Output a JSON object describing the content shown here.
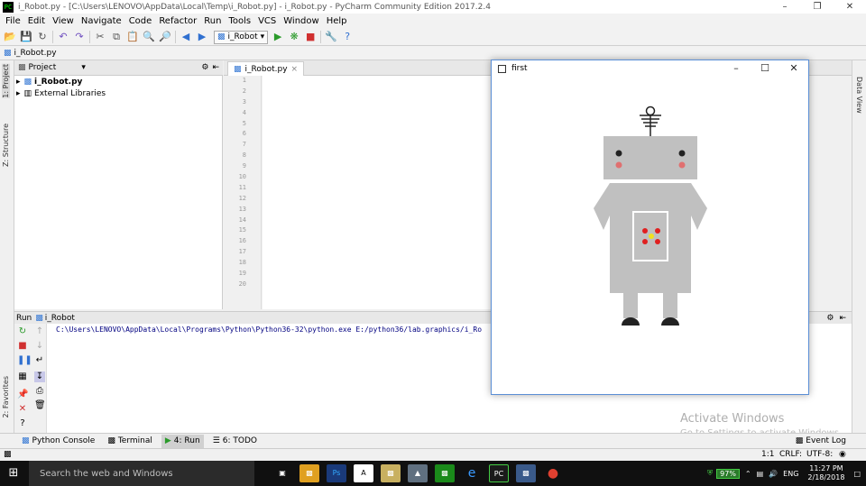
{
  "window": {
    "title": "i_Robot.py - [C:\\Users\\LENOVO\\AppData\\Local\\Temp\\i_Robot.py] - i_Robot.py - PyCharm Community Edition 2017.2.4",
    "app_icon_text": "PC",
    "controls": {
      "minimize": "–",
      "restore": "❐",
      "close": "✕"
    }
  },
  "menu": [
    "File",
    "Edit",
    "View",
    "Navigate",
    "Code",
    "Refactor",
    "Run",
    "Tools",
    "VCS",
    "Window",
    "Help"
  ],
  "toolbar": {
    "run_config": "i_Robot"
  },
  "navbar": {
    "breadcrumb": "i_Robot.py"
  },
  "left_strip": {
    "project_tab": "1: Project",
    "structure_tab": "Z: Structure",
    "favorites_tab": "2: Favorites"
  },
  "right_strip": {
    "data_view_tab": "Data View"
  },
  "project": {
    "header": "Project",
    "items": [
      {
        "label": "i_Robot.py"
      },
      {
        "label": "External Libraries"
      }
    ]
  },
  "editor": {
    "tab": "i_Robot.py",
    "line_numbers": [
      "1",
      "2",
      "3",
      "4",
      "5",
      "6",
      "7",
      "8",
      "9",
      "10",
      "11",
      "12",
      "13",
      "14",
      "15",
      "16",
      "17",
      "18",
      "19",
      "20"
    ]
  },
  "run": {
    "header_label": "Run",
    "config": "i_Robot",
    "console_text": "C:\\Users\\LENOVO\\AppData\\Local\\Programs\\Python\\Python36-32\\python.exe E:/python36/lab.graphics/i_Ro"
  },
  "bottom_tabs": {
    "python_console": "Python Console",
    "terminal": "Terminal",
    "run": "4: Run",
    "todo": "6: TODO",
    "event_log": "Event Log"
  },
  "status": {
    "position": "1:1",
    "line_sep": "CRLF:",
    "encoding": "UTF-8:"
  },
  "watermark": {
    "line1": "Activate Windows",
    "line2": "Go to Settings to activate Windows."
  },
  "gl_window": {
    "title": "first"
  },
  "taskbar": {
    "search": "Search the web and Windows",
    "battery": "97%",
    "lang": "ENG",
    "time": "11:27 PM",
    "date": "2/18/2018"
  },
  "colors": {
    "robot_gray": "#c0c0c0",
    "robot_dark": "#222222",
    "cheek": "#e07070",
    "button_red": "#e02020",
    "button_yellow": "#f0e020"
  }
}
